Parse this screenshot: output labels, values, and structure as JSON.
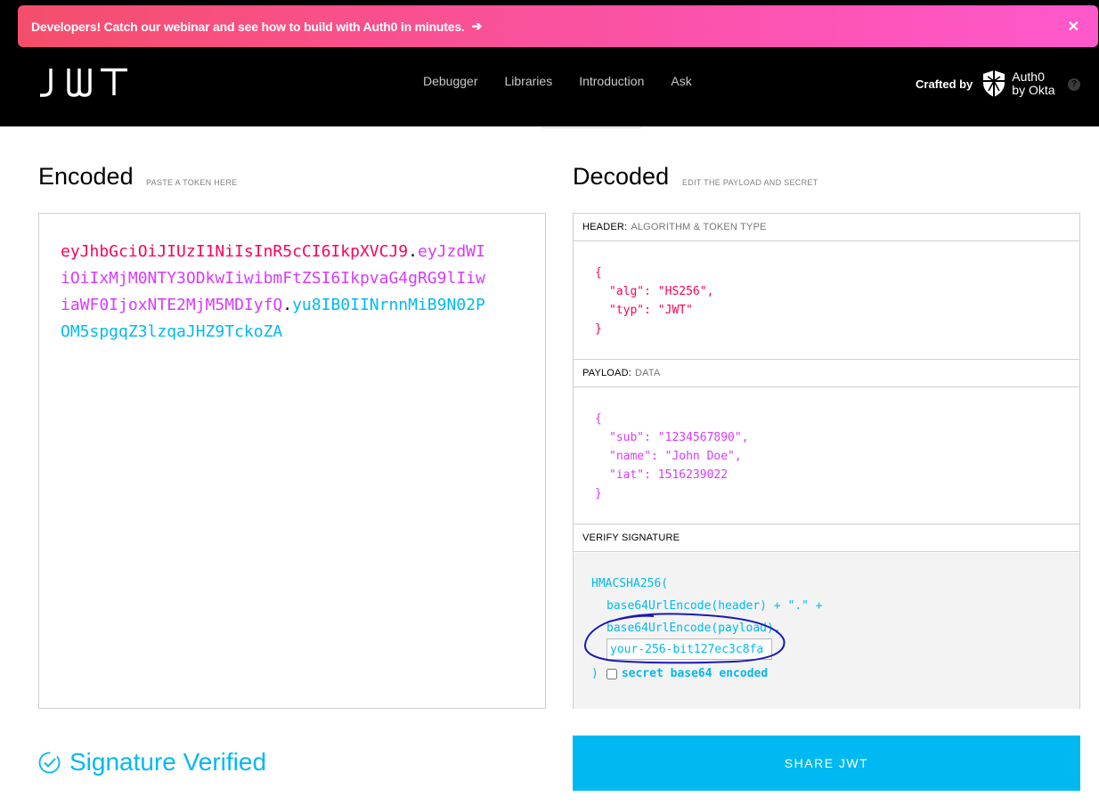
{
  "banner": {
    "text": "Developers! Catch our webinar and see how to build with Auth0 in minutes.",
    "arrow": "➔",
    "close": "✕"
  },
  "header": {
    "logo_text": "JWT",
    "nav": [
      "Debugger",
      "Libraries",
      "Introduction",
      "Ask"
    ],
    "crafted_by": "Crafted by",
    "brand_line1": "Auth0",
    "brand_line2": "by Okta",
    "help": "?"
  },
  "encoded": {
    "title": "Encoded",
    "subtitle": "PASTE A TOKEN HERE",
    "token_header": "eyJhbGciOiJIUzI1NiIsInR5cCI6IkpXVCJ9",
    "token_payload": "eyJzdWIiOiIxMjM0NTY3ODkwIiwibmFtZSI6IkpvaG4gRG9lIiwiaWF0IjoxNTE2MjM5MDIyfQ",
    "token_signature": "yu8IB0IINrnnMiB9N02POM5spgqZ3lzqaJHZ9TckoZA",
    "dot": "."
  },
  "decoded": {
    "title": "Decoded",
    "subtitle": "EDIT THE PAYLOAD AND SECRET",
    "header_label": "HEADER:",
    "header_sub": "ALGORITHM & TOKEN TYPE",
    "header_json": {
      "open": "{",
      "alg": "\"alg\": \"HS256\",",
      "typ": "\"typ\": \"JWT\"",
      "close": "}"
    },
    "payload_label": "PAYLOAD:",
    "payload_sub": "DATA",
    "payload_json": {
      "open": "{",
      "sub": "\"sub\": \"1234567890\",",
      "name": "\"name\": \"John Doe\",",
      "iat": "\"iat\": 1516239022",
      "close": "}"
    },
    "verify_label": "VERIFY SIGNATURE",
    "verify": {
      "line1": "HMACSHA256(",
      "line2": "base64UrlEncode(header) + \".\" +",
      "line3": "base64UrlEncode(payload),",
      "secret_value": "your-256-bit127ec3c8fa",
      "close_paren": ")",
      "secret_b64_label": "secret base64 encoded"
    }
  },
  "status": {
    "verified_text": "Signature Verified",
    "verified_icon": "check-circle-icon"
  },
  "share": {
    "label": "SHARE JWT"
  },
  "colors": {
    "header_red": "#fb015b",
    "payload_purple": "#d63aff",
    "signature_blue": "#00b9f1",
    "annotation_navy": "#1a1ab5"
  }
}
